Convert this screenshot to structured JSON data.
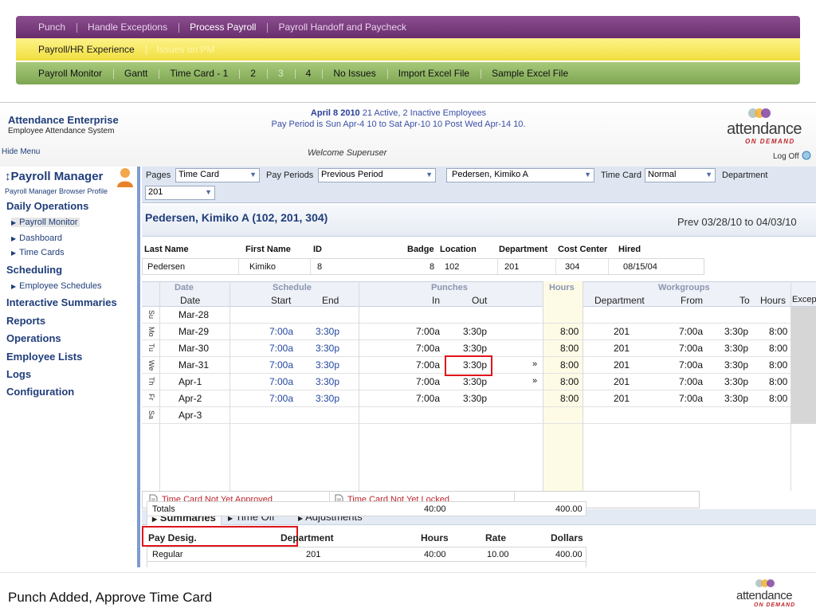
{
  "nav": {
    "row1": [
      "Punch",
      "Handle Exceptions",
      "Process Payroll",
      "Payroll Handoff and Paycheck"
    ],
    "row1_active": "Process Payroll",
    "row2": [
      "Payroll/HR Experience",
      "Issues on PM"
    ],
    "row3": [
      "Payroll Monitor",
      "Gantt",
      "Time Card - 1",
      "2",
      "3",
      "4",
      "No Issues",
      "Import Excel File",
      "Sample Excel File"
    ]
  },
  "header": {
    "brand_title": "Attendance Enterprise",
    "brand_sub": "Employee Attendance System",
    "hide_menu": "Hide Menu",
    "date_bold": "April 8 2010",
    "employees": "21 Active, 2 Inactive Employees",
    "pay_period": "Pay Period is Sun Apr-4 10 to Sat Apr-10 10 Post Wed Apr-14 10.",
    "welcome": "Welcome Superuser",
    "logo_word": "attendance",
    "logo_tag": "ON DEMAND",
    "logout": "Log Off"
  },
  "sidebar": {
    "title": "↕Payroll Manager",
    "profile": "Payroll Manager Browser Profile",
    "sections": [
      {
        "label": "Daily Operations",
        "items": [
          "Payroll Monitor",
          "Dashboard",
          "Time Cards"
        ]
      },
      {
        "label": "Scheduling",
        "items": [
          "Employee Schedules"
        ]
      },
      {
        "label": "Interactive Summaries",
        "items": []
      },
      {
        "label": "Reports",
        "items": []
      },
      {
        "label": "Operations",
        "items": []
      },
      {
        "label": "Employee Lists",
        "items": []
      },
      {
        "label": "Logs",
        "items": []
      },
      {
        "label": "Configuration",
        "items": []
      }
    ]
  },
  "filters": {
    "pages_label": "Pages",
    "pages_value": "Time Card",
    "periods_label": "Pay Periods",
    "periods_value": "Previous Period",
    "employee_value": "Pedersen, Kimiko A",
    "timecard_label": "Time Card",
    "timecard_value": "Normal",
    "department_label": "Department",
    "department_value": "201"
  },
  "employee": {
    "title": "Pedersen, Kimiko A (102, 201, 304)",
    "range": "Prev 03/28/10 to 04/03/10",
    "headers": [
      "Last Name",
      "First Name",
      "ID",
      "Badge",
      "Location",
      "Department",
      "Cost Center",
      "Hired"
    ],
    "values": [
      "Pedersen",
      "Kimiko",
      "8",
      "8",
      "102",
      "201",
      "304",
      "08/15/04"
    ]
  },
  "grid": {
    "groups": [
      "Date",
      "Schedule",
      "Punches",
      "Hours",
      "Workgroups"
    ],
    "columns": [
      "Date",
      "Start",
      "End",
      "In",
      "Out",
      "Department",
      "From",
      "To",
      "Hours",
      "Excep"
    ],
    "rows": [
      {
        "day": "Su",
        "date": "Mar-28",
        "start": "",
        "end": "",
        "in": "",
        "out": "",
        "chev": "",
        "hours": "",
        "dept": "",
        "from": "",
        "to": "",
        "wh": ""
      },
      {
        "day": "Mo",
        "date": "Mar-29",
        "start": "7:00a",
        "end": "3:30p",
        "in": "7:00a",
        "out": "3:30p",
        "chev": "",
        "hours": "8:00",
        "dept": "201",
        "from": "7:00a",
        "to": "3:30p",
        "wh": "8:00"
      },
      {
        "day": "Tu",
        "date": "Mar-30",
        "start": "7:00a",
        "end": "3:30p",
        "in": "7:00a",
        "out": "3:30p",
        "chev": "",
        "hours": "8:00",
        "dept": "201",
        "from": "7:00a",
        "to": "3:30p",
        "wh": "8:00"
      },
      {
        "day": "We",
        "date": "Mar-31",
        "start": "7:00a",
        "end": "3:30p",
        "in": "7:00a",
        "out": "3:30p",
        "chev": "»",
        "hours": "8:00",
        "dept": "201",
        "from": "7:00a",
        "to": "3:30p",
        "wh": "8:00"
      },
      {
        "day": "Th",
        "date": "Apr-1",
        "start": "7:00a",
        "end": "3:30p",
        "in": "7:00a",
        "out": "3:30p",
        "chev": "»",
        "hours": "8:00",
        "dept": "201",
        "from": "7:00a",
        "to": "3:30p",
        "wh": "8:00"
      },
      {
        "day": "Fr",
        "date": "Apr-2",
        "start": "7:00a",
        "end": "3:30p",
        "in": "7:00a",
        "out": "3:30p",
        "chev": "",
        "hours": "8:00",
        "dept": "201",
        "from": "7:00a",
        "to": "3:30p",
        "wh": "8:00"
      },
      {
        "day": "Sa",
        "date": "Apr-3",
        "start": "",
        "end": "",
        "in": "",
        "out": "",
        "chev": "",
        "hours": "",
        "dept": "",
        "from": "",
        "to": "",
        "wh": ""
      }
    ]
  },
  "status": {
    "approved": "Time Card Not Yet Approved",
    "locked": "Time Card Not Yet Locked"
  },
  "tabs": [
    "Summaries",
    "Time Off",
    "Adjustments"
  ],
  "summary": {
    "headers": [
      "Pay Desig.",
      "Department",
      "Hours",
      "Rate",
      "Dollars"
    ],
    "rows": [
      {
        "desig": "Regular",
        "dept": "201",
        "hours": "40:00",
        "rate": "10.00",
        "dollars": "400.00"
      },
      {
        "desig": "Totals",
        "dept": "",
        "hours": "40:00",
        "rate": "",
        "dollars": "400.00"
      }
    ]
  },
  "caption": "Punch Added, Approve Time Card",
  "colors": {
    "accent_blue": "#1f3d7a",
    "highlight_red": "#e0141c",
    "nav_purple": "#6a2e6e",
    "nav_yellow": "#f0df3e",
    "nav_green": "#7fa653"
  }
}
